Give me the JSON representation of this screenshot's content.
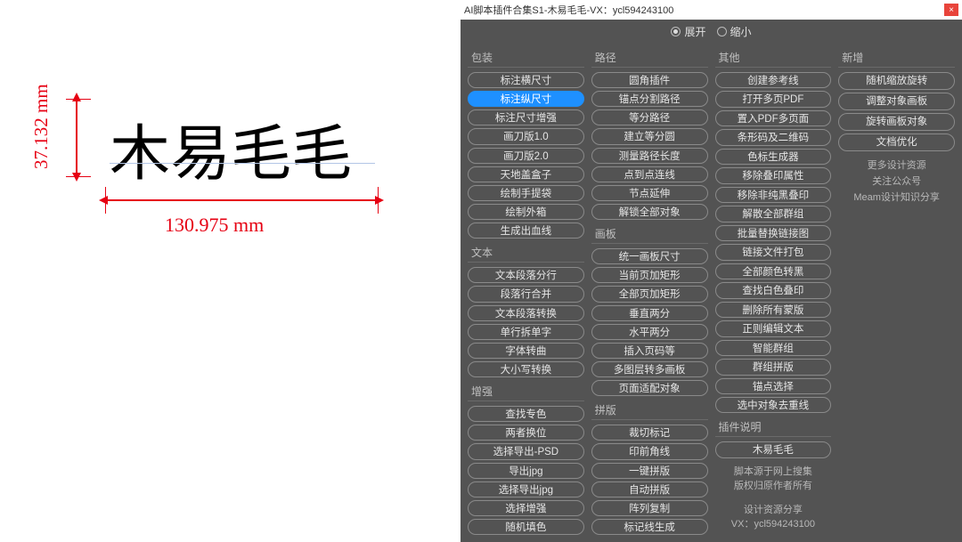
{
  "canvas": {
    "text": "木易毛毛",
    "v_label": "37.132 mm",
    "h_label": "130.975 mm"
  },
  "panel": {
    "title": "AI脚本插件合集S1-木易毛毛-VX：ycl594243100",
    "close": "×",
    "mode": {
      "expand": "展开",
      "shrink": "缩小"
    },
    "col1": {
      "g1": {
        "title": "包装",
        "items": [
          "标注横尺寸",
          "标注纵尺寸",
          "标注尺寸增强",
          "画刀版1.0",
          "画刀版2.0",
          "天地盖盒子",
          "绘制手提袋",
          "绘制外箱",
          "生成出血线"
        ]
      },
      "g2": {
        "title": "文本",
        "items": [
          "文本段落分行",
          "段落行合并",
          "文本段落转换",
          "单行拆单字",
          "字体转曲",
          "大小写转换"
        ]
      },
      "g3": {
        "title": "增强",
        "items": [
          "查找专色",
          "两者换位",
          "选择导出-PSD",
          "导出jpg",
          "选择导出jpg",
          "选择增强",
          "随机填色"
        ]
      }
    },
    "col2": {
      "g1": {
        "title": "路径",
        "items": [
          "圆角插件",
          "锚点分割路径",
          "等分路径",
          "建立等分圆",
          "测量路径长度",
          "点到点连线",
          "节点延伸",
          "解锁全部对象"
        ]
      },
      "g2": {
        "title": "画板",
        "items": [
          "统一画板尺寸",
          "当前页加矩形",
          "全部页加矩形",
          "垂直两分",
          "水平两分",
          "插入页码等",
          "多图层转多画板",
          "页面适配对象"
        ]
      },
      "g3": {
        "title": "拼版",
        "items": [
          "裁切标记",
          "印前角线",
          "一键拼版",
          "自动拼版",
          "阵列复制",
          "标记线生成"
        ]
      }
    },
    "col3": {
      "g1": {
        "title": "其他",
        "items": [
          "创建参考线",
          "打开多页PDF",
          "置入PDF多页面",
          "条形码及二维码",
          "色标生成器",
          "移除叠印属性",
          "移除非纯黑叠印",
          "解散全部群组",
          "批量替换链接图",
          "链接文件打包",
          "全部颜色转黑",
          "查找白色叠印",
          "删除所有蒙版",
          "正则编辑文本",
          "智能群组",
          "群组拼版",
          "锚点选择",
          "选中对象去重线"
        ]
      },
      "g2": {
        "title": "插件说明",
        "items": [
          "木易毛毛"
        ]
      }
    },
    "col4": {
      "g1": {
        "title": "新增",
        "items": [
          "随机缩放旋转",
          "调整对象画板",
          "旋转画板对象",
          "文档优化"
        ]
      }
    },
    "info1": {
      "l1": "更多设计资源",
      "l2": "关注公众号",
      "l3": "Meam设计知识分享"
    },
    "info2": {
      "l1": "脚本源于网上搜集",
      "l2": "版权归原作者所有"
    },
    "info3": {
      "l1": "设计资源分享",
      "l2": "VX：ycl594243100"
    }
  }
}
